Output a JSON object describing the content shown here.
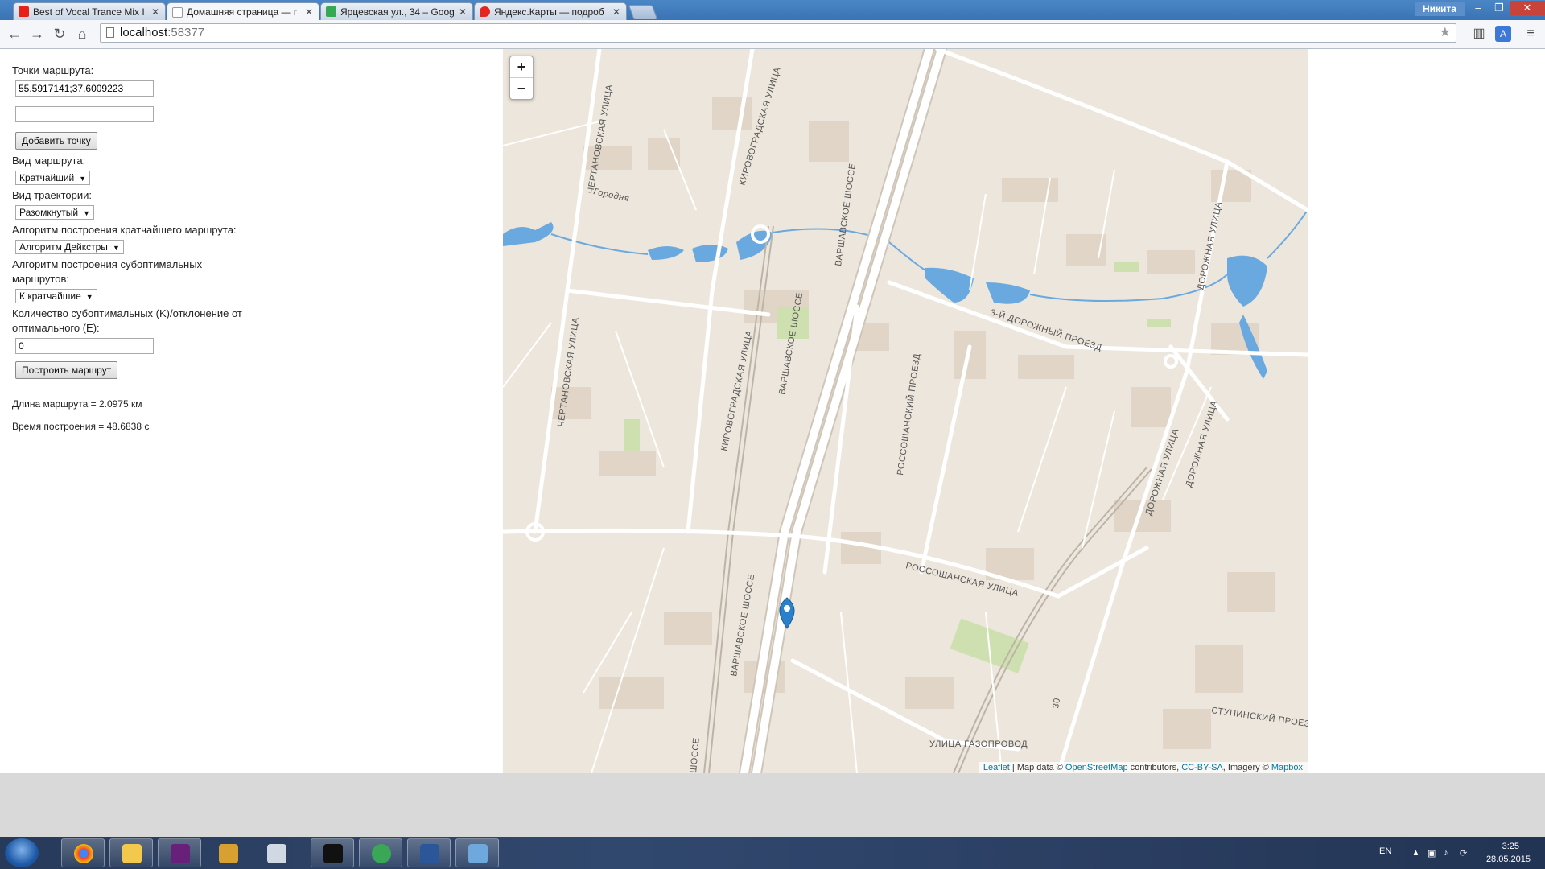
{
  "browser": {
    "tabs": [
      {
        "title": "Best of Vocal Trance Mix I",
        "favicon_color": "#e62117",
        "active": false
      },
      {
        "title": "Домашняя страница — г",
        "favicon_color": "#ffffff",
        "active": true
      },
      {
        "title": "Ярцевская ул., 34 – Goog",
        "favicon_color": "#34a853",
        "active": false
      },
      {
        "title": "Яндекс.Карты — подроб",
        "favicon_color": "#e52620",
        "active": false
      }
    ],
    "tab_close_glyph": "✕",
    "user_name": "Никита",
    "address": {
      "host": "localhost",
      "port": ":58377"
    },
    "window_controls": {
      "minimize": "–",
      "restore": "❐",
      "close": "✕"
    }
  },
  "form": {
    "points_label": "Точки маршрута:",
    "point_values": [
      "55.5917141;37.6009223",
      ""
    ],
    "add_point_button": "Добавить точку",
    "route_type_label": "Вид маршрута:",
    "route_type_value": "Кратчайший",
    "trajectory_label": "Вид траектории:",
    "trajectory_value": "Разомкнутый",
    "shortest_alg_label": "Алгоритм построения кратчайшего маршрута:",
    "shortest_alg_value": "Алгоритм Дейкстры",
    "subopt_alg_label": "Алгоритм построения субоптимальных маршрутов:",
    "subopt_alg_value": "К кратчайшие",
    "k_label": "Количество субоптимальных (K)/отклонение от оптимального (E):",
    "k_value": "0",
    "build_button": "Построить маршрут",
    "route_length": "Длина маршрута = 2.0975 км",
    "build_time": "Время построения = 48.6838 с"
  },
  "map": {
    "zoom_in": "+",
    "zoom_out": "−",
    "attribution": {
      "leaflet": "Leaflet",
      "sep1": " | Map data © ",
      "osm": "OpenStreetMap",
      "contrib": " contributors, ",
      "license": "CC-BY-SA",
      "imagery": ", Imagery © ",
      "mapbox": "Mapbox"
    },
    "streets": {
      "chertanovskaya_top": "ЧЕРТАНОВСКАЯ УЛИЦА",
      "chertanovskaya_bottom": "ЧЕРТАНОВСКАЯ УЛИЦА",
      "kirovogradskaya_top": "КИРОВОГРАДСКАЯ УЛИЦА",
      "kirovogradskaya_mid": "КИРОВОГРАДСКАЯ УЛИЦА",
      "varshavskoe_1": "ВАРШАВСКОЕ ШОССЕ",
      "varshavskoe_2": "ВАРШАВСКОЕ ШОССЕ",
      "varshavskoe_3": "ВАРШАВСКОЕ ШОССЕ",
      "varshavskoe_4": "ШОССЕ",
      "dorozhny_proezd": "3-Й ДОРОЖНЫЙ ПРОЕЗД",
      "dorozhnaya_1": "ДОРОЖНАЯ УЛИЦА",
      "dorozhnaya_2": "ДОРОЖНАЯ УЛИЦА",
      "dorozhnaya_3": "ДОРОЖНАЯ УЛИЦА",
      "rossoshansky": "РОССОШАНСКИЙ ПРОЕЗД",
      "rossoshanskaya": "РОССОШАНСКАЯ УЛИЦА",
      "gazoprovod": "УЛИЦА ГАЗОПРОВОД",
      "stupinsky": "СТУПИНСКИЙ ПРОЕЗД",
      "gorodnya": "Городня",
      "rail_label": "30"
    },
    "marker_color": "#2a81cb",
    "water_color": "#6aa9e0",
    "road_color": "#ffffff"
  },
  "taskbar": {
    "apps": [
      {
        "name": "chrome",
        "color": "#e84235"
      },
      {
        "name": "explorer",
        "color": "#f2c94c"
      },
      {
        "name": "visual-studio",
        "color": "#68217a"
      },
      {
        "name": "tools",
        "color": "#d8a030"
      },
      {
        "name": "calculator",
        "color": "#cfd8e3"
      },
      {
        "name": "cmd",
        "color": "#111111"
      },
      {
        "name": "globe",
        "color": "#3aa757"
      },
      {
        "name": "word",
        "color": "#2b579a"
      },
      {
        "name": "network",
        "color": "#6fa8dc"
      }
    ],
    "lang": "EN",
    "time": "3:25",
    "date": "28.05.2015"
  }
}
